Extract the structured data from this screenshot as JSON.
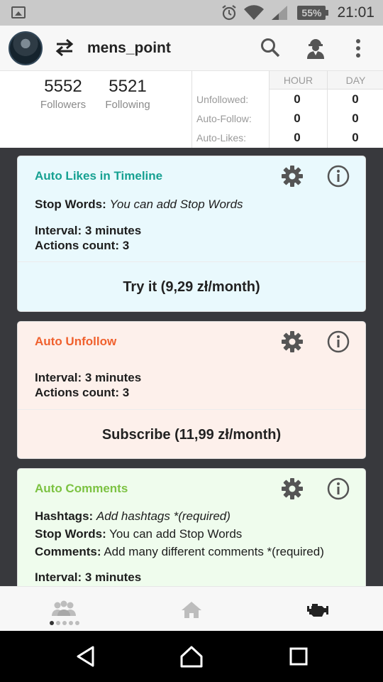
{
  "status_bar": {
    "battery": "55%",
    "time": "21:01"
  },
  "header": {
    "username": "mens_point"
  },
  "stats": {
    "followers_count": "5552",
    "followers_label": "Followers",
    "following_count": "5521",
    "following_label": "Following",
    "table": {
      "col_hour": "HOUR",
      "col_day": "DAY",
      "rows": [
        {
          "label": "Unfollowed:",
          "hour": "0",
          "day": "0"
        },
        {
          "label": "Auto-Follow:",
          "hour": "0",
          "day": "0"
        },
        {
          "label": "Auto-Likes:",
          "hour": "0",
          "day": "0"
        }
      ]
    }
  },
  "cards": [
    {
      "title": "Auto Likes in Timeline",
      "title_color": "#17a192",
      "stop_words_key": "Stop Words:",
      "stop_words_value": "You can add Stop Words",
      "interval": "Interval: 3 minutes",
      "actions": "Actions count: 3",
      "button": "Try it (9,29 zł/month)"
    },
    {
      "title": "Auto Unfollow",
      "title_color": "#f0612e",
      "interval": "Interval: 3 minutes",
      "actions": "Actions count: 3",
      "button": "Subscribe (11,99 zł/month)"
    },
    {
      "title": "Auto Comments",
      "title_color": "#7cc242",
      "hashtags_key": "Hashtags:",
      "hashtags_value": "Add hashtags *(required)",
      "stop_words_key": "Stop Words:",
      "stop_words_value": "You can add Stop Words",
      "comments_key": "Comments:",
      "comments_value": "Add many different comments *(required)",
      "interval": "Interval: 3 minutes"
    }
  ],
  "tabs": [
    {
      "icon": "people-icon",
      "active": true
    },
    {
      "icon": "home-icon",
      "active": false
    },
    {
      "icon": "engine-icon",
      "active": false
    }
  ],
  "nav": [
    "back-icon",
    "home-icon",
    "recents-icon"
  ]
}
